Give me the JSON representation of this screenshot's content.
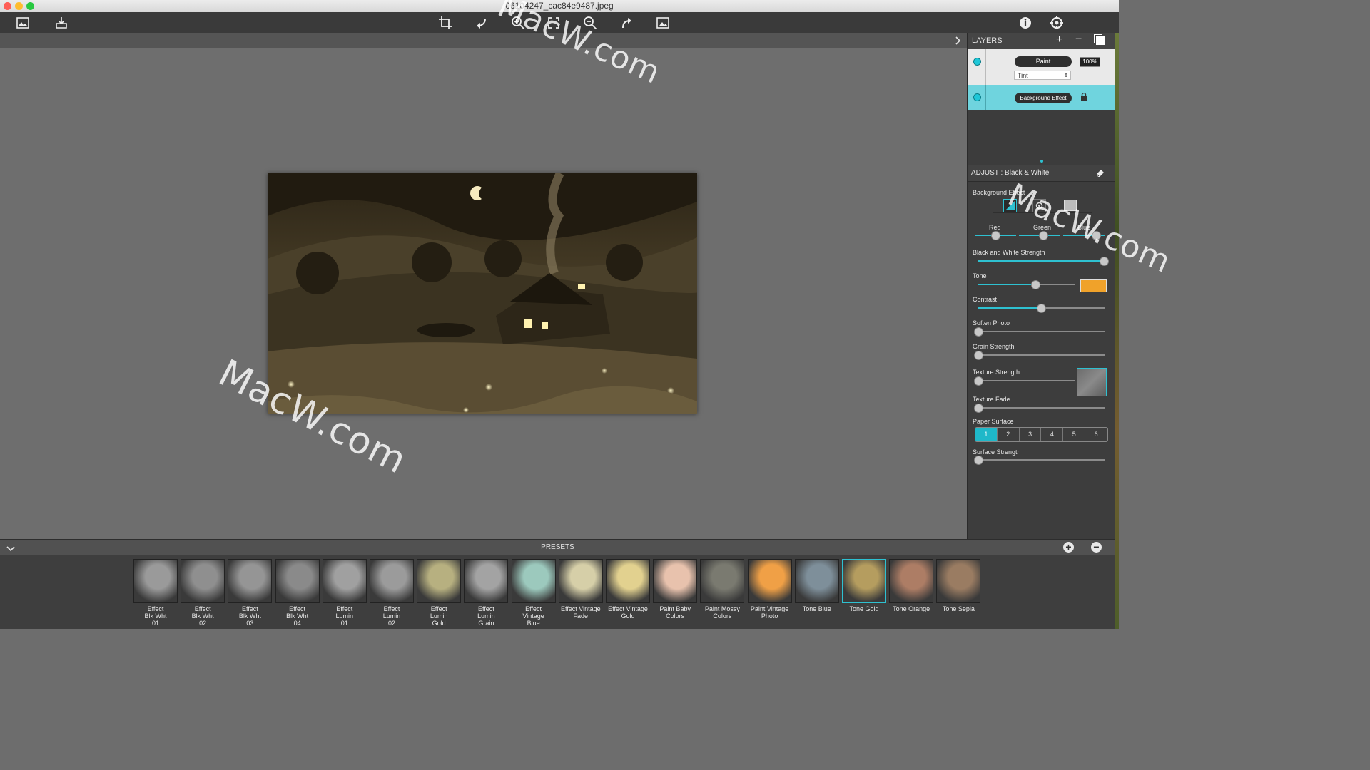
{
  "window": {
    "title": "06104247_cac84e9487.jpeg",
    "light_colors": [
      "#fe5f57",
      "#febc2e",
      "#28c840"
    ]
  },
  "toolbar": {
    "left_icons": [
      "image-browse-icon",
      "export-icon"
    ],
    "center_icons": [
      "crop-icon",
      "undo-icon",
      "zoom-in-icon",
      "fit-icon",
      "zoom-out-icon",
      "redo-icon",
      "compare-icon"
    ],
    "right_icons": [
      "info-icon",
      "settings-icon"
    ]
  },
  "layers": {
    "title": "LAYERS",
    "paint_label": "Paint",
    "opacity": "100%",
    "blend_mode": "Tint",
    "background_label": "Background Effect"
  },
  "adjust": {
    "title": "ADJUST : Black & White",
    "section": "Background Effect",
    "channels": [
      "Red",
      "Green",
      "Blue"
    ],
    "channel_levels": [
      0.45,
      0.55,
      0.8
    ],
    "sliders": [
      {
        "label": "Black and White Strength",
        "level": 1.0
      },
      {
        "label": "Tone",
        "level": 0.6
      },
      {
        "label": "Contrast",
        "level": 0.5
      },
      {
        "label": "Soften Photo",
        "level": 0.0
      },
      {
        "label": "Grain Strength",
        "level": 0.0
      },
      {
        "label": "Texture Strength",
        "level": 0.0
      },
      {
        "label": "Texture Fade",
        "level": 0.0
      }
    ],
    "tone_color": "#f0a22a",
    "paper_surface_label": "Paper Surface",
    "paper_options": [
      "1",
      "2",
      "3",
      "4",
      "5",
      "6"
    ],
    "paper_selected": "1",
    "surface_strength_label": "Surface Strength",
    "surface_strength_level": 0.0
  },
  "presets": {
    "title": "PRESETS",
    "items": [
      {
        "label": "Effect\nBlk Wht\n01",
        "tint": "#9a9a9a"
      },
      {
        "label": "Effect\nBlk Wht\n02",
        "tint": "#8f8f8f"
      },
      {
        "label": "Effect\nBlk Wht\n03",
        "tint": "#959595"
      },
      {
        "label": "Effect\nBlk Wht\n04",
        "tint": "#8a8a8a"
      },
      {
        "label": "Effect\nLumin\n01",
        "tint": "#a0a0a0"
      },
      {
        "label": "Effect\nLumin\n02",
        "tint": "#9b9b9b"
      },
      {
        "label": "Effect\nLumin\nGold",
        "tint": "#b7b080"
      },
      {
        "label": "Effect\nLumin\nGrain",
        "tint": "#a3a3a3"
      },
      {
        "label": "Effect\nVintage\nBlue",
        "tint": "#9cc9bd"
      },
      {
        "label": "Effect Vintage\nFade",
        "tint": "#d6cfa8"
      },
      {
        "label": "Effect Vintage\nGold",
        "tint": "#e2d18f"
      },
      {
        "label": "Paint Baby\nColors",
        "tint": "#e8c2ad"
      },
      {
        "label": "Paint Mossy\nColors",
        "tint": "#7a7a70"
      },
      {
        "label": "Paint Vintage\nPhoto",
        "tint": "#f0a046"
      },
      {
        "label": "Tone Blue",
        "tint": "#7e8f9a"
      },
      {
        "label": "Tone Gold",
        "tint": "#b59d5f"
      },
      {
        "label": "Tone Orange",
        "tint": "#ad7d65"
      },
      {
        "label": "Tone Sepia",
        "tint": "#9a7c62"
      }
    ],
    "selected": "Tone Gold"
  },
  "watermark": "MacW.com"
}
